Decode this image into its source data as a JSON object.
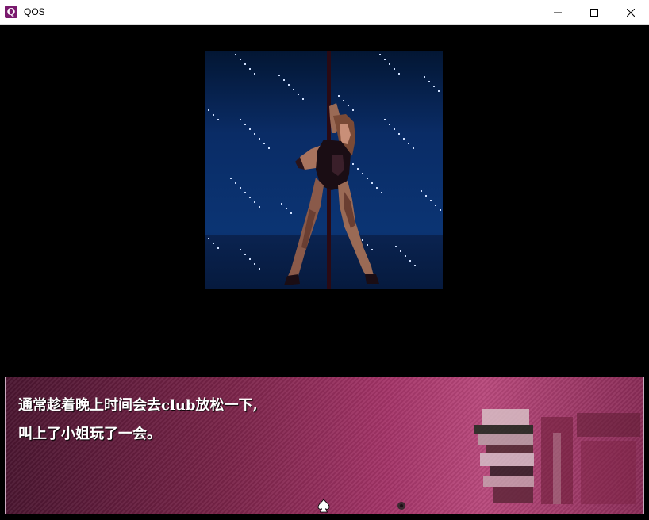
{
  "window": {
    "title": "QOS",
    "icon_letter": "Q",
    "controls": [
      "minimize-icon",
      "maximize-icon",
      "close-icon"
    ]
  },
  "scene": {
    "description_icon": "pole-dancer-sprite"
  },
  "dialogue": {
    "lines": [
      "通常趁着晚上时间会去club放松一下,",
      "叫上了小姐玩了一会。"
    ],
    "advance_icon": "spade-icon"
  },
  "colors": {
    "dialogue_bg": "#a43468",
    "scene_bg": "#0b3473",
    "app_icon": "#7a1a6e"
  }
}
